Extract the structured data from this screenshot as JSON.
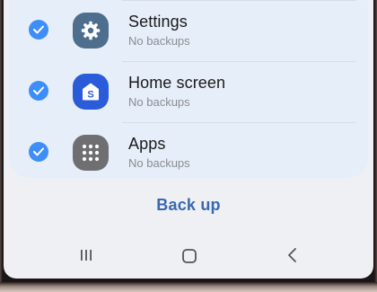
{
  "backup_items": [
    {
      "title": "Settings",
      "status": "No backups",
      "icon": "gear-icon"
    },
    {
      "title": "Home screen",
      "status": "No backups",
      "icon": "home-screen-icon"
    },
    {
      "title": "Apps",
      "status": "No backups",
      "icon": "apps-grid-icon"
    }
  ],
  "actions": {
    "back_up_label": "Back up"
  },
  "colors": {
    "accent": "#3e8ef7",
    "button_text": "#3a68b0",
    "card_bg": "#e6eef9"
  },
  "navigation": [
    "recents-icon",
    "home-icon",
    "back-icon"
  ]
}
